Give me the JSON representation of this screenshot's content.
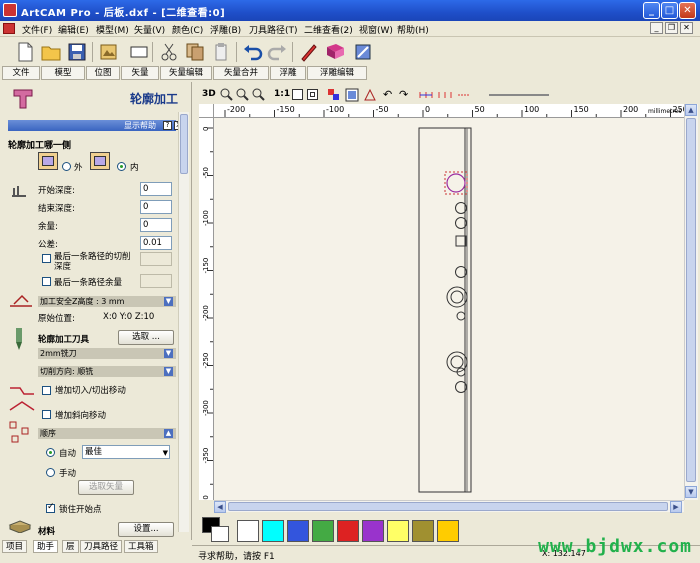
{
  "window": {
    "title": "ArtCAM Pro - 后板.dxf - [二维查看:0]"
  },
  "menu": [
    "文件(F)",
    "编辑(E)",
    "模型(M)",
    "矢量(V)",
    "颜色(C)",
    "浮雕(B)",
    "刀具路径(T)",
    "二维查看(2)",
    "视窗(W)",
    "帮助(H)"
  ],
  "panel_tabs": [
    "文件",
    "模型",
    "位图",
    "矢量",
    "矢量编辑",
    "矢量合并",
    "浮雕",
    "浮雕编辑"
  ],
  "panel": {
    "title": "轮廓加工",
    "help_bar": "显示帮助",
    "help_btn": "?",
    "close_btn": "X",
    "side_heading": "轮廓加工哪一侧",
    "outside_label": "外",
    "inside_label": "内",
    "start_depth_label": "开始深度:",
    "start_depth": "0",
    "finish_depth_label": "结束深度:",
    "finish_depth": "0",
    "allowance_label": "余量:",
    "allowance": "0",
    "tolerance_label": "公差:",
    "tolerance": "0.01",
    "last_pass_depth_label": "最后一条路径的切削深度",
    "last_pass_allowance_label": "最后一条路径余量",
    "safe_z_label": "加工安全Z高度 : 3 mm",
    "home_label": "原始位置:",
    "home_value": "X:0 Y:0 Z:10",
    "tool_heading": "轮廓加工刀具",
    "select_btn": "选取 ...",
    "tool_name": "2mm铣刀",
    "cut_direction": "切削方向: 顺铣",
    "lead_in_label": "增加切入/切出移动",
    "ramp_label": "增加斜向移动",
    "order_bar": "顺序",
    "auto_label": "自动",
    "auto_value": "最佳",
    "manual_label": "手动",
    "pick_vector_btn": "选取矢量",
    "lock_start_label": "锁住开始点",
    "material_label": "材料",
    "setup_btn": "设置..."
  },
  "bottom_tabs": [
    "项目",
    "助手",
    "层",
    "刀具路径",
    "工具箱"
  ],
  "view_toolbar": {
    "items": [
      "3D",
      "1:1"
    ]
  },
  "ruler": {
    "top_labels": [
      "-200",
      "-150",
      "-100",
      "-50",
      "0",
      "50",
      "100",
      "150",
      "200",
      "250"
    ],
    "unit": "millimetres",
    "left_labels": [
      "0",
      "-50",
      "-100",
      "-150",
      "-200",
      "-250",
      "-300",
      "-350",
      "-400"
    ]
  },
  "palette": [
    "#000000",
    "#ffffff",
    "#00ffff",
    "#3355dd",
    "#44aa44",
    "#dd2222",
    "#9933cc",
    "#ffff66",
    "#a09030",
    "#ffcc00"
  ],
  "status": {
    "text": "寻求帮助，请按 F1",
    "coords": "X: 132.147"
  },
  "watermark": "www.bjdwx.com"
}
